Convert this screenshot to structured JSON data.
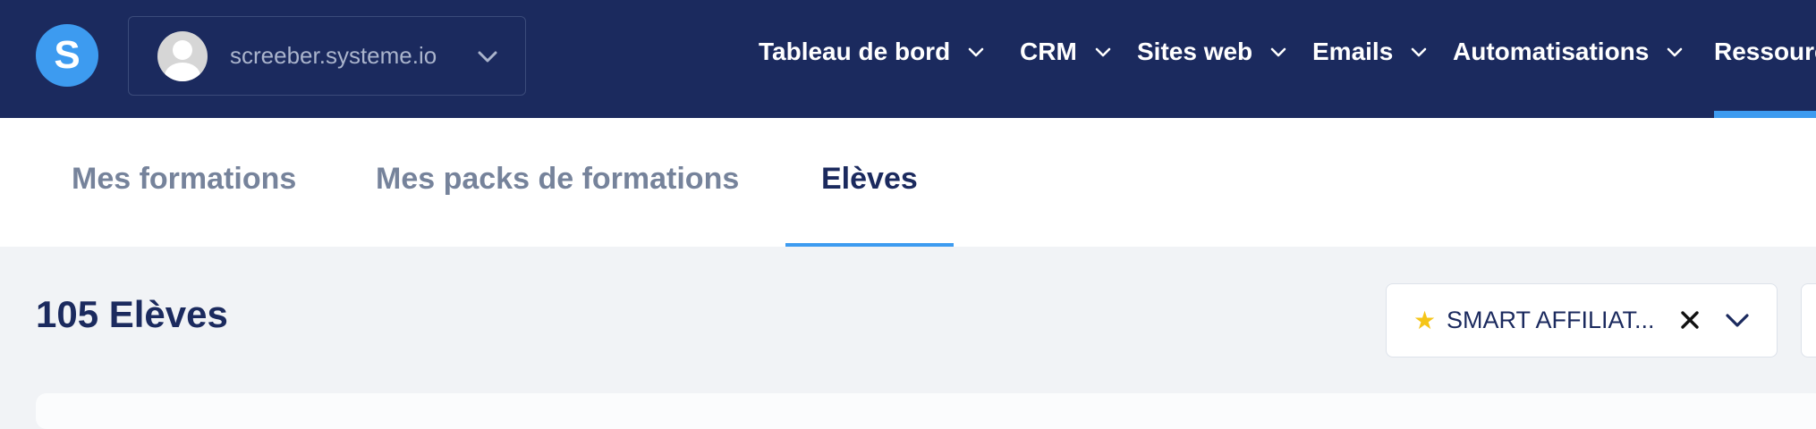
{
  "app": {
    "logo_letter": "S",
    "account_name": "screeber.systeme.io"
  },
  "nav": {
    "items": [
      {
        "label": "Tableau de bord"
      },
      {
        "label": "CRM"
      },
      {
        "label": "Sites web"
      },
      {
        "label": "Emails"
      },
      {
        "label": "Automatisations"
      },
      {
        "label": "Ressourc"
      }
    ]
  },
  "tabs": [
    {
      "label": "Mes formations"
    },
    {
      "label": "Mes packs de formations"
    },
    {
      "label": "Elèves",
      "active": true
    }
  ],
  "main": {
    "count_title": "105 Elèves",
    "filter": {
      "icon": "star-icon",
      "value": "SMART AFFILIAT..."
    }
  },
  "colors": {
    "header_bg": "#1b2a5e",
    "accent": "#3d9bf0",
    "tab_inactive": "#76839b",
    "page_bg": "#f1f3f6"
  }
}
